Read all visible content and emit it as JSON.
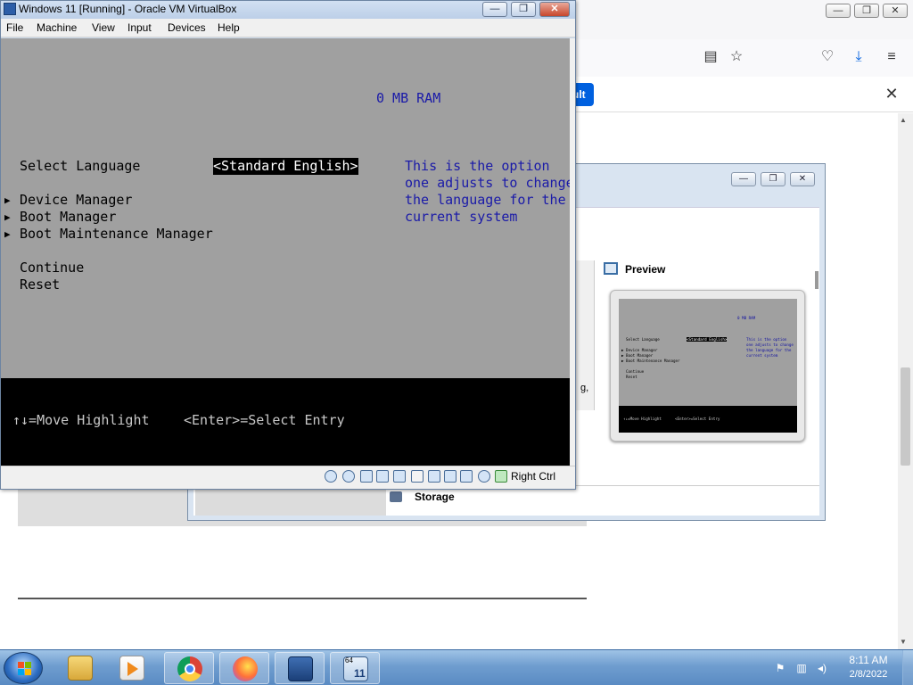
{
  "firefox": {
    "notification_button": "ult",
    "window_controls": {
      "minimize": "—",
      "restore": "❐",
      "close": "✕"
    },
    "toolbar_icons": {
      "reader": "▤",
      "bookmark": "☆",
      "pocket": "♡",
      "download": "⤓",
      "menu": "≡"
    },
    "notification_close": "✕"
  },
  "manager": {
    "window_controls": {
      "minimize": "—",
      "restore": "❐",
      "close": "✕"
    },
    "preview_title": "Preview",
    "storage_label": "Storage",
    "truncated_text": "g,",
    "preview_screen": {
      "ram": "0 MB RAM",
      "select_language": "Select Language",
      "language_value": "<Standard English>",
      "help": [
        "This is the option",
        "one adjusts to change",
        "the language for the",
        "current system"
      ],
      "items": [
        "▶ Device Manager",
        "▶ Boot Manager",
        "▶ Boot Maintenance Manager"
      ],
      "continue": "Continue",
      "reset": "Reset",
      "footer": "↑↓=Move Highlight      <Enter>=Select Entry"
    }
  },
  "vm_window": {
    "title": "Windows 11 [Running] - Oracle VM VirtualBox",
    "window_controls": {
      "minimize": "—",
      "restore": "❐",
      "close": "✕"
    },
    "menu": [
      "File",
      "Machine",
      "View",
      "Input",
      "Devices",
      "Help"
    ],
    "host_key": "Right Ctrl",
    "status_icons": [
      "hard-disk-icon",
      "optical-disk-icon",
      "audio-icon",
      "network-icon",
      "usb-icon",
      "shared-folders-icon",
      "display-icon",
      "video-capture-icon",
      "virtualization-icon",
      "cpu-icon",
      "mouse-integration-icon",
      "keyboard-icon"
    ]
  },
  "bios": {
    "ram": "0 MB RAM",
    "select_language_label": "Select Language",
    "language_value": "<Standard English>",
    "help_lines": [
      "This is the option",
      "one adjusts to change",
      "the language for the",
      "current system"
    ],
    "menu_items": [
      {
        "arrow": "▶",
        "label": "Device Manager"
      },
      {
        "arrow": "▶",
        "label": "Boot Manager"
      },
      {
        "arrow": "▶",
        "label": "Boot Maintenance Manager"
      }
    ],
    "continue": "Continue",
    "reset": "Reset",
    "footer_move": "↑↓=Move Highlight",
    "footer_select": "<Enter>=Select Entry"
  },
  "taskbar": {
    "time": "8:11 AM",
    "date": "2/8/2022",
    "apps": [
      "file-explorer",
      "media-player",
      "chrome",
      "firefox",
      "virtualbox",
      "windows-11-vm"
    ],
    "vm_badge": "64",
    "vm_number": "11"
  },
  "colors": {
    "bios_background": "#a0a0a0",
    "bios_help_text": "#1a1aa8",
    "taskbar": "#6f9dcf",
    "firefox_accent": "#0060df"
  }
}
